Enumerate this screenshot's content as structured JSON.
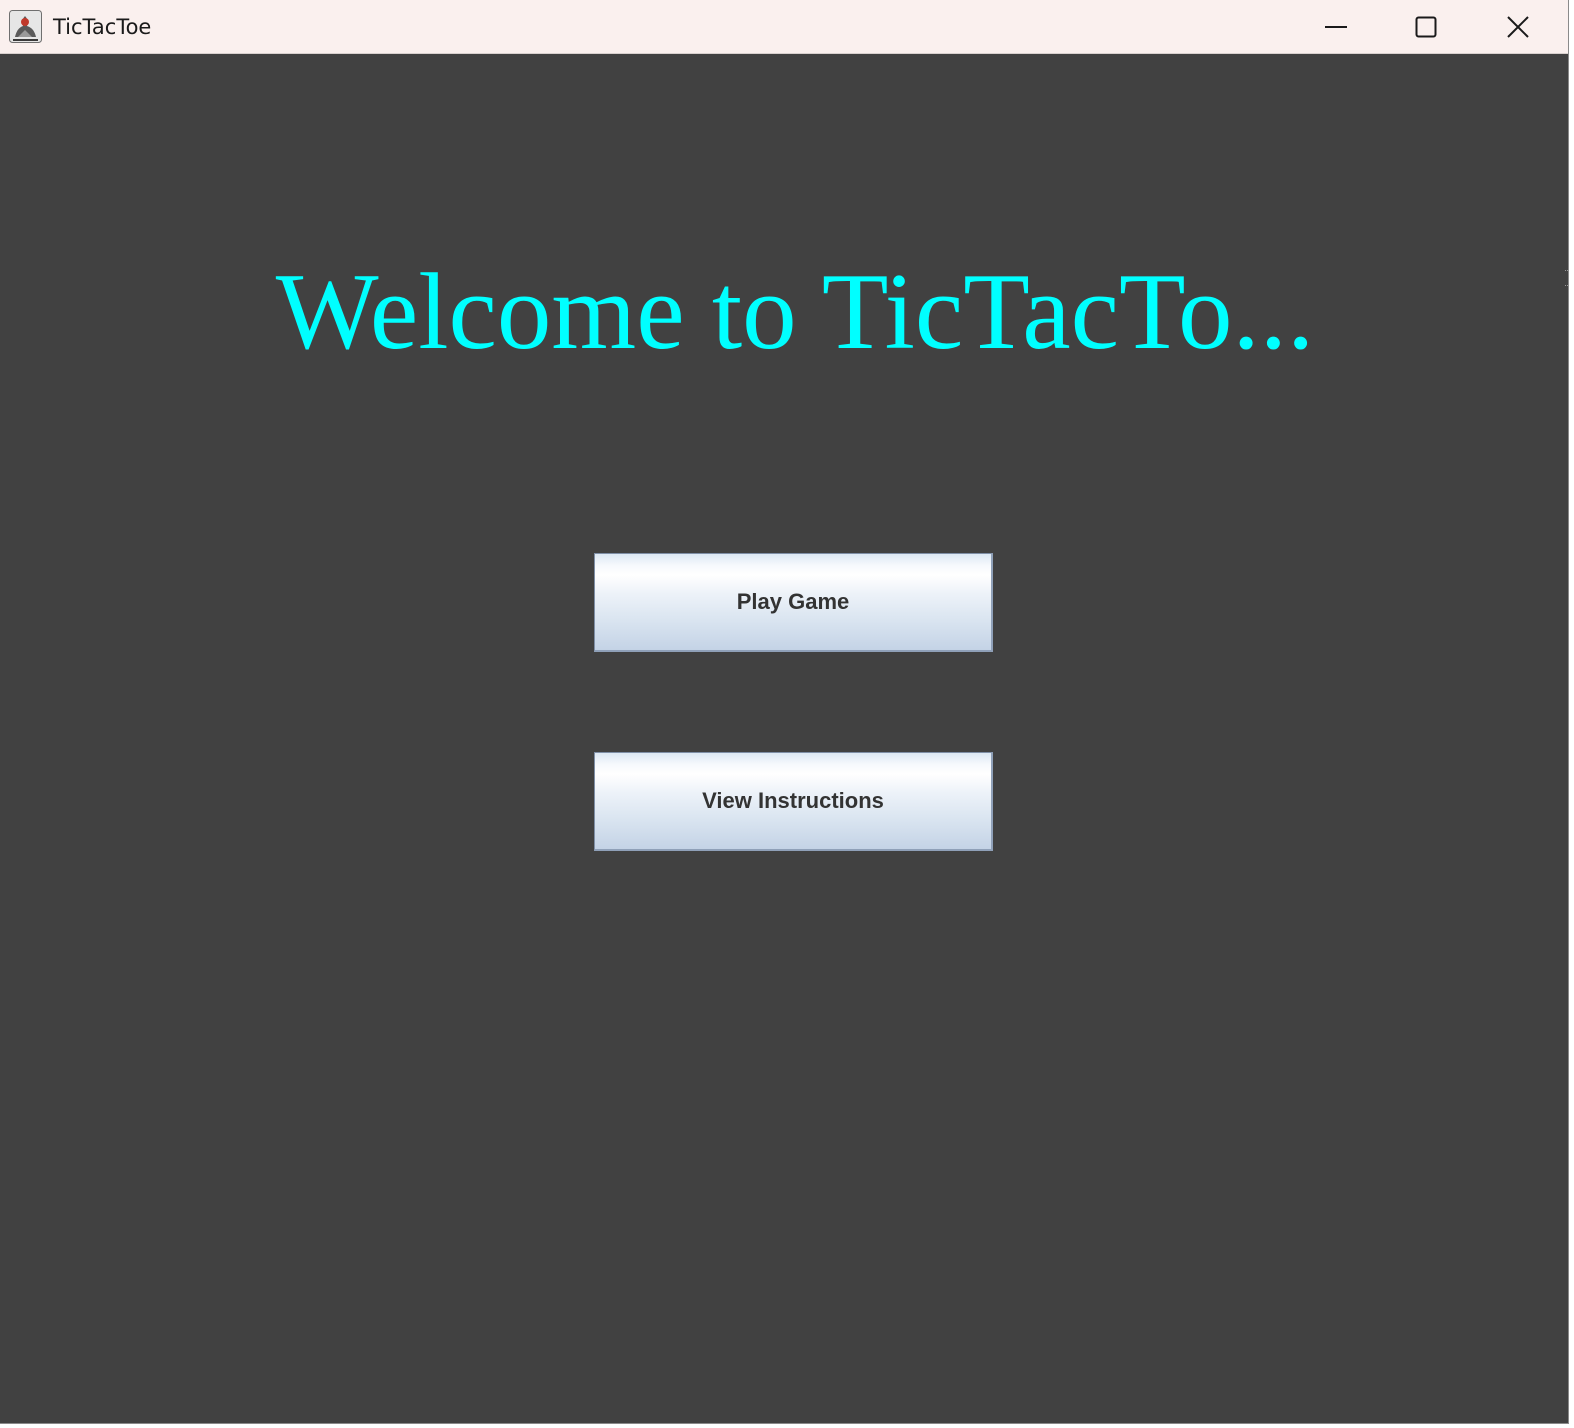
{
  "window": {
    "title": "TicTacToe",
    "icon": "java-app-icon",
    "controls": {
      "minimize_icon": "minimize-icon",
      "maximize_icon": "maximize-icon",
      "close_icon": "close-icon"
    }
  },
  "main": {
    "heading": "Welcome to TicTacTo...",
    "buttons": {
      "play_label": "Play Game",
      "instructions_label": "View Instructions"
    }
  },
  "colors": {
    "background": "#414141",
    "heading": "#00ffff",
    "titlebar": "#faf0ee",
    "button_text": "#333333"
  }
}
